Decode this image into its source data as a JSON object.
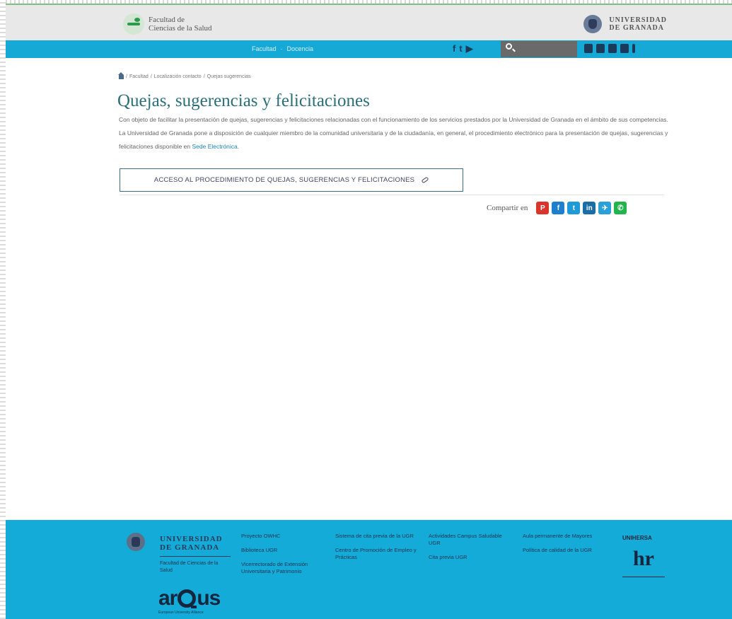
{
  "header": {
    "faculty_name_line1": "Facultad de",
    "faculty_name_line2": "Ciencias de la Salud",
    "university_line1": "UNIVERSIDAD",
    "university_line2": "DE GRANADA"
  },
  "nav": {
    "links": [
      "Facultad",
      "Docencia"
    ],
    "social_icons": [
      "facebook-icon",
      "twitter-icon",
      "youtube-icon"
    ],
    "search_placeholder": "",
    "utility_icons": [
      "mail-icon",
      "calendar-icon",
      "users-icon",
      "accessibility-icon",
      "info-icon"
    ]
  },
  "breadcrumb": {
    "items": [
      "Facultad",
      "Localización contacto",
      "Quejas sugerencias"
    ],
    "separator": "/"
  },
  "main": {
    "title": "Quejas, sugerencias y felicitaciones",
    "intro_text": "Con objeto de facilitar la presentación de quejas, sugerencias y felicitaciones relacionadas con el funcionamiento de los servicios prestados por la Universidad de Granada en el ámbito de sus competencias. La Universidad de Granada pone a disposición de cualquier miembro de la comunidad universitaria y de la ciudadanía, en general, el procedimiento electrónico para la presentación de quejas, sugerencias y felicitaciones disponible en",
    "intro_link": "Sede Electrónica",
    "intro_end": ".",
    "access_button_label": "ACCESO AL PROCEDIMIENTO DE QUEJAS, SUGERENCIAS Y FELICITACIONES"
  },
  "share": {
    "label": "Compartir en",
    "buttons": [
      {
        "name": "pdf-icon",
        "glyph": "P",
        "color": "#d9352b"
      },
      {
        "name": "facebook-icon",
        "glyph": "f",
        "color": "#1f7fce"
      },
      {
        "name": "twitter-icon",
        "glyph": "t",
        "color": "#1f9ad8"
      },
      {
        "name": "linkedin-icon",
        "glyph": "in",
        "color": "#1a6ea8"
      },
      {
        "name": "telegram-icon",
        "glyph": "✈",
        "color": "#2aa0d8"
      },
      {
        "name": "whatsapp-icon",
        "glyph": "✆",
        "color": "#21b44a"
      }
    ]
  },
  "footer": {
    "university_line1": "UNIVERSIDAD",
    "university_line2": "DE GRANADA",
    "faculty": "Facultad de Ciencias de la Salud",
    "arqus_a": "ar",
    "arqus_b": "us",
    "arqus_sub": "European University Alliance",
    "col1": [
      "Proyecto OWHC",
      "Biblioteca UGR",
      "Vicerrectorado de Extensión Universitaria y Patrimonio"
    ],
    "col2": [
      "Sistema de cita previa de la UGR",
      "Centro de Promoción de Empleo y Prácticas"
    ],
    "col3": [
      "Actividades Campus Saludable UGR",
      "Cita previa UGR"
    ],
    "col4": [
      "Aula permanente de Mayores",
      "Política de calidad de la UGR"
    ],
    "unihersa": "UNIHERSA",
    "hr_logo": "hr"
  }
}
